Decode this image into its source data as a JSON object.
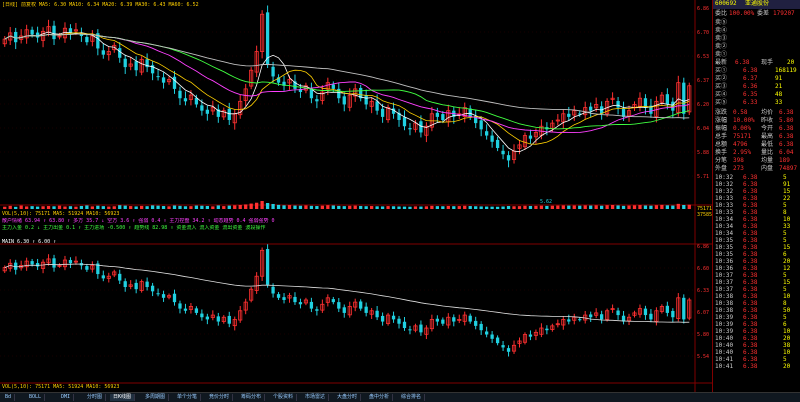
{
  "colors": {
    "up": "#ff3030",
    "down": "#20d0e0",
    "ma1": "#ffffff",
    "ma2": "#ffd000",
    "ma3": "#ff40ff",
    "ma4": "#40ff40",
    "ma5": "#c0c0c0",
    "grid": "#800000",
    "text": "#c0c0c0",
    "yellow": "#ffff00",
    "green": "#00ff00"
  },
  "header": {
    "title": "[日线] 前复权 MA5: 6.30 MA10: 6.34 MA20: 6.39 MA30: 6.43 MA60: 6.52"
  },
  "main_axis": {
    "ticks": [
      "6.86",
      "6.70",
      "6.53",
      "6.37",
      "6.20",
      "6.04",
      "5.88",
      "5.71"
    ],
    "low_mark": "5.62"
  },
  "vol_axis": {
    "ticks": [
      "75171",
      "37585"
    ]
  },
  "indicator_axis": {
    "ticks": [
      "6.86",
      "6.60",
      "6.33",
      "6.07",
      "5.80",
      "5.54"
    ]
  },
  "indicator_lines": [
    "VOL(5,10): 75171 MA5: 51924 MA10: 56923",
    "散户情绪 63.94 ↑ 63.80 ↑ 多方 35.7 ↓ 空方 3.6 ↑ 强弱 0.4 ↑ 主力控盘 34.2 ↑ 动态趋势 0.4 强弱强势 0",
    "主力入金 0.2 ↓ 主力出金 0.1 ↑ 主力进场 -0.500 ↑ 趋势线 82.98 ↑ 资金流入 流入资金 流出资金 波段操作",
    "MAIN 6.30 ↑ 6.00 ↑"
  ],
  "bottom_lines": [
    "VOL(5,10): 75171 MA5: 51924 MA10: 56923"
  ],
  "chart_data": {
    "type": "candlestick",
    "closes": [
      6.68,
      6.72,
      6.66,
      6.7,
      6.74,
      6.71,
      6.69,
      6.73,
      6.76,
      6.68,
      6.7,
      6.75,
      6.72,
      6.74,
      6.7,
      6.66,
      6.7,
      6.62,
      6.58,
      6.6,
      6.64,
      6.56,
      6.5,
      6.52,
      6.48,
      6.55,
      6.5,
      6.46,
      6.44,
      6.4,
      6.42,
      6.36,
      6.3,
      6.28,
      6.32,
      6.26,
      6.22,
      6.2,
      6.24,
      6.18,
      6.22,
      6.16,
      6.2,
      6.28,
      6.36,
      6.48,
      6.6,
      6.84,
      6.52,
      6.44,
      6.4,
      6.38,
      6.42,
      6.36,
      6.34,
      6.38,
      6.3,
      6.28,
      6.34,
      6.4,
      6.36,
      6.3,
      6.26,
      6.32,
      6.36,
      6.3,
      6.26,
      6.28,
      6.22,
      6.18,
      6.24,
      6.2,
      6.16,
      6.12,
      6.1,
      6.14,
      6.08,
      6.12,
      6.2,
      6.18,
      6.16,
      6.22,
      6.18,
      6.2,
      6.24,
      6.18,
      6.14,
      6.1,
      6.06,
      6.02,
      5.98,
      5.94,
      5.9,
      5.96,
      6.0,
      6.06,
      6.04,
      6.08,
      6.12,
      6.1,
      6.14,
      6.16,
      6.2,
      6.18,
      6.22,
      6.2,
      6.24,
      6.22,
      6.26,
      6.2,
      6.28,
      6.3,
      6.24,
      6.18,
      6.22,
      6.26,
      6.3,
      6.24,
      6.2,
      6.28,
      6.32,
      6.26,
      6.22,
      6.4,
      6.2,
      6.38
    ],
    "volumes": [
      40,
      55,
      38,
      60,
      45,
      50,
      42,
      48,
      52,
      47,
      58,
      44,
      49,
      41,
      53,
      62,
      46,
      57,
      50,
      43,
      48,
      66,
      59,
      51,
      45,
      54,
      49,
      63,
      58,
      52,
      47,
      61,
      55,
      48,
      50,
      60,
      57,
      53,
      46,
      62,
      51,
      59,
      64,
      70,
      80,
      95,
      110,
      140,
      105,
      88,
      72,
      64,
      68,
      60,
      57,
      62,
      55,
      52,
      58,
      66,
      61,
      54,
      50,
      56,
      59,
      53,
      49,
      52,
      47,
      45,
      51,
      48,
      44,
      42,
      40,
      46,
      43,
      47,
      55,
      50,
      48,
      53,
      49,
      51,
      56,
      52,
      48,
      45,
      43,
      41,
      39,
      44,
      52,
      48,
      50,
      56,
      53,
      55,
      58,
      54,
      57,
      60,
      62,
      59,
      61,
      58,
      63,
      60,
      64,
      57,
      66,
      70,
      62,
      55,
      60,
      64,
      68,
      61,
      58,
      66,
      72,
      64,
      60,
      90,
      70,
      75
    ],
    "ma_series": [
      {
        "values_note": "computed"
      }
    ]
  },
  "panel": {
    "code": "600692",
    "name": "亚通股份",
    "weibi_label": "委比",
    "weibi_value": "100.00%",
    "weicha_label": "委差",
    "weicha_value": "179207",
    "sell": [
      {
        "label": "卖⑤",
        "price": "",
        "vol": ""
      },
      {
        "label": "卖④",
        "price": "",
        "vol": ""
      },
      {
        "label": "卖③",
        "price": "",
        "vol": ""
      },
      {
        "label": "卖②",
        "price": "",
        "vol": ""
      },
      {
        "label": "卖①",
        "price": "",
        "vol": ""
      }
    ],
    "buy": [
      {
        "label": "买①",
        "price": "6.38",
        "vol": "168119"
      },
      {
        "label": "买②",
        "price": "6.37",
        "vol": "91"
      },
      {
        "label": "买③",
        "price": "6.36",
        "vol": "21"
      },
      {
        "label": "买④",
        "price": "6.35",
        "vol": "48"
      },
      {
        "label": "买⑤",
        "price": "6.33",
        "vol": "33"
      }
    ],
    "latest_label": "最新",
    "latest": "6.38",
    "xianshou_label": "现手",
    "xianshou": "20",
    "stats": [
      {
        "l1": "涨跌",
        "v1": "0.58",
        "l2": "均价",
        "v2": "6.38"
      },
      {
        "l1": "涨幅",
        "v1": "10.00%",
        "l2": "昨收",
        "v2": "5.80"
      },
      {
        "l1": "振幅",
        "v1": "0.00%",
        "l2": "今开",
        "v2": "6.38"
      },
      {
        "l1": "总手",
        "v1": "75171",
        "l2": "最高",
        "v2": "6.38"
      },
      {
        "l1": "总额",
        "v1": "4796",
        "l2": "最低",
        "v2": "6.38"
      },
      {
        "l1": "换手",
        "v1": "2.95%",
        "l2": "量比",
        "v2": "6.04"
      },
      {
        "l1": "分笔",
        "v1": "398",
        "l2": "均量",
        "v2": "189"
      },
      {
        "l1": "外盘",
        "v1": "273",
        "l2": "内盘",
        "v2": "74897"
      }
    ],
    "ticks": [
      {
        "t": "10:32",
        "p": "6.38",
        "v": "5"
      },
      {
        "t": "10:32",
        "p": "6.38",
        "v": "91"
      },
      {
        "t": "10:32",
        "p": "6.38",
        "v": "15"
      },
      {
        "t": "10:33",
        "p": "6.38",
        "v": "22"
      },
      {
        "t": "10:33",
        "p": "6.38",
        "v": "5"
      },
      {
        "t": "10:33",
        "p": "6.38",
        "v": "8"
      },
      {
        "t": "10:34",
        "p": "6.38",
        "v": "10"
      },
      {
        "t": "10:34",
        "p": "6.38",
        "v": "33"
      },
      {
        "t": "10:34",
        "p": "6.38",
        "v": "5"
      },
      {
        "t": "10:35",
        "p": "6.38",
        "v": "5"
      },
      {
        "t": "10:35",
        "p": "6.38",
        "v": "15"
      },
      {
        "t": "10:35",
        "p": "6.38",
        "v": "6"
      },
      {
        "t": "10:36",
        "p": "6.38",
        "v": "20"
      },
      {
        "t": "10:36",
        "p": "6.38",
        "v": "12"
      },
      {
        "t": "10:37",
        "p": "6.38",
        "v": "5"
      },
      {
        "t": "10:37",
        "p": "6.38",
        "v": "15"
      },
      {
        "t": "10:37",
        "p": "6.38",
        "v": "5"
      },
      {
        "t": "10:38",
        "p": "6.38",
        "v": "10"
      },
      {
        "t": "10:38",
        "p": "6.38",
        "v": "8"
      },
      {
        "t": "10:38",
        "p": "6.38",
        "v": "50"
      },
      {
        "t": "10:39",
        "p": "6.38",
        "v": "5"
      },
      {
        "t": "10:39",
        "p": "6.38",
        "v": "6"
      },
      {
        "t": "10:39",
        "p": "6.38",
        "v": "10"
      },
      {
        "t": "10:40",
        "p": "6.38",
        "v": "20"
      },
      {
        "t": "10:40",
        "p": "6.38",
        "v": "38"
      },
      {
        "t": "10:40",
        "p": "6.38",
        "v": "10"
      },
      {
        "t": "10:41",
        "p": "6.38",
        "v": "5"
      },
      {
        "t": "10:41",
        "p": "6.38",
        "v": "20"
      }
    ]
  },
  "tabs": [
    "Bd",
    "BOLL",
    "DMI",
    "分时图",
    "日K线图",
    "多周期图",
    "单个分笔",
    "竞价分时",
    "筹码分布",
    "个股资料",
    "市场雷达",
    "大盘分时",
    "盘中分析",
    "综合排名"
  ]
}
